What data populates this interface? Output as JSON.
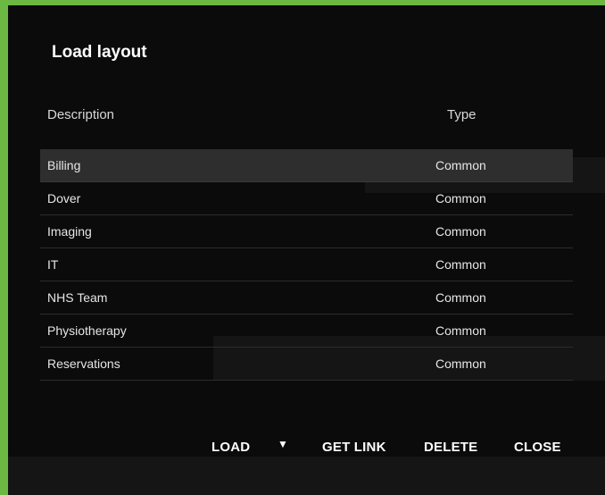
{
  "dialog": {
    "title": "Load layout",
    "columns": {
      "description": "Description",
      "type": "Type"
    },
    "rows": [
      {
        "description": "Billing",
        "type": "Common",
        "selected": true
      },
      {
        "description": "Dover",
        "type": "Common",
        "selected": false
      },
      {
        "description": "Imaging",
        "type": "Common",
        "selected": false
      },
      {
        "description": "IT",
        "type": "Common",
        "selected": false
      },
      {
        "description": "NHS Team",
        "type": "Common",
        "selected": false
      },
      {
        "description": "Physiotherapy",
        "type": "Common",
        "selected": false
      },
      {
        "description": "Reservations",
        "type": "Common",
        "selected": false
      }
    ],
    "actions": {
      "load": "LOAD",
      "load_menu_icon": "caret-down-icon",
      "get_link": "GET LINK",
      "delete": "DELETE",
      "close": "CLOSE"
    }
  },
  "colors": {
    "accent_border": "#6bb843",
    "dialog_bg": "#0b0b0b",
    "selected_row_bg": "#2e2e2e"
  }
}
